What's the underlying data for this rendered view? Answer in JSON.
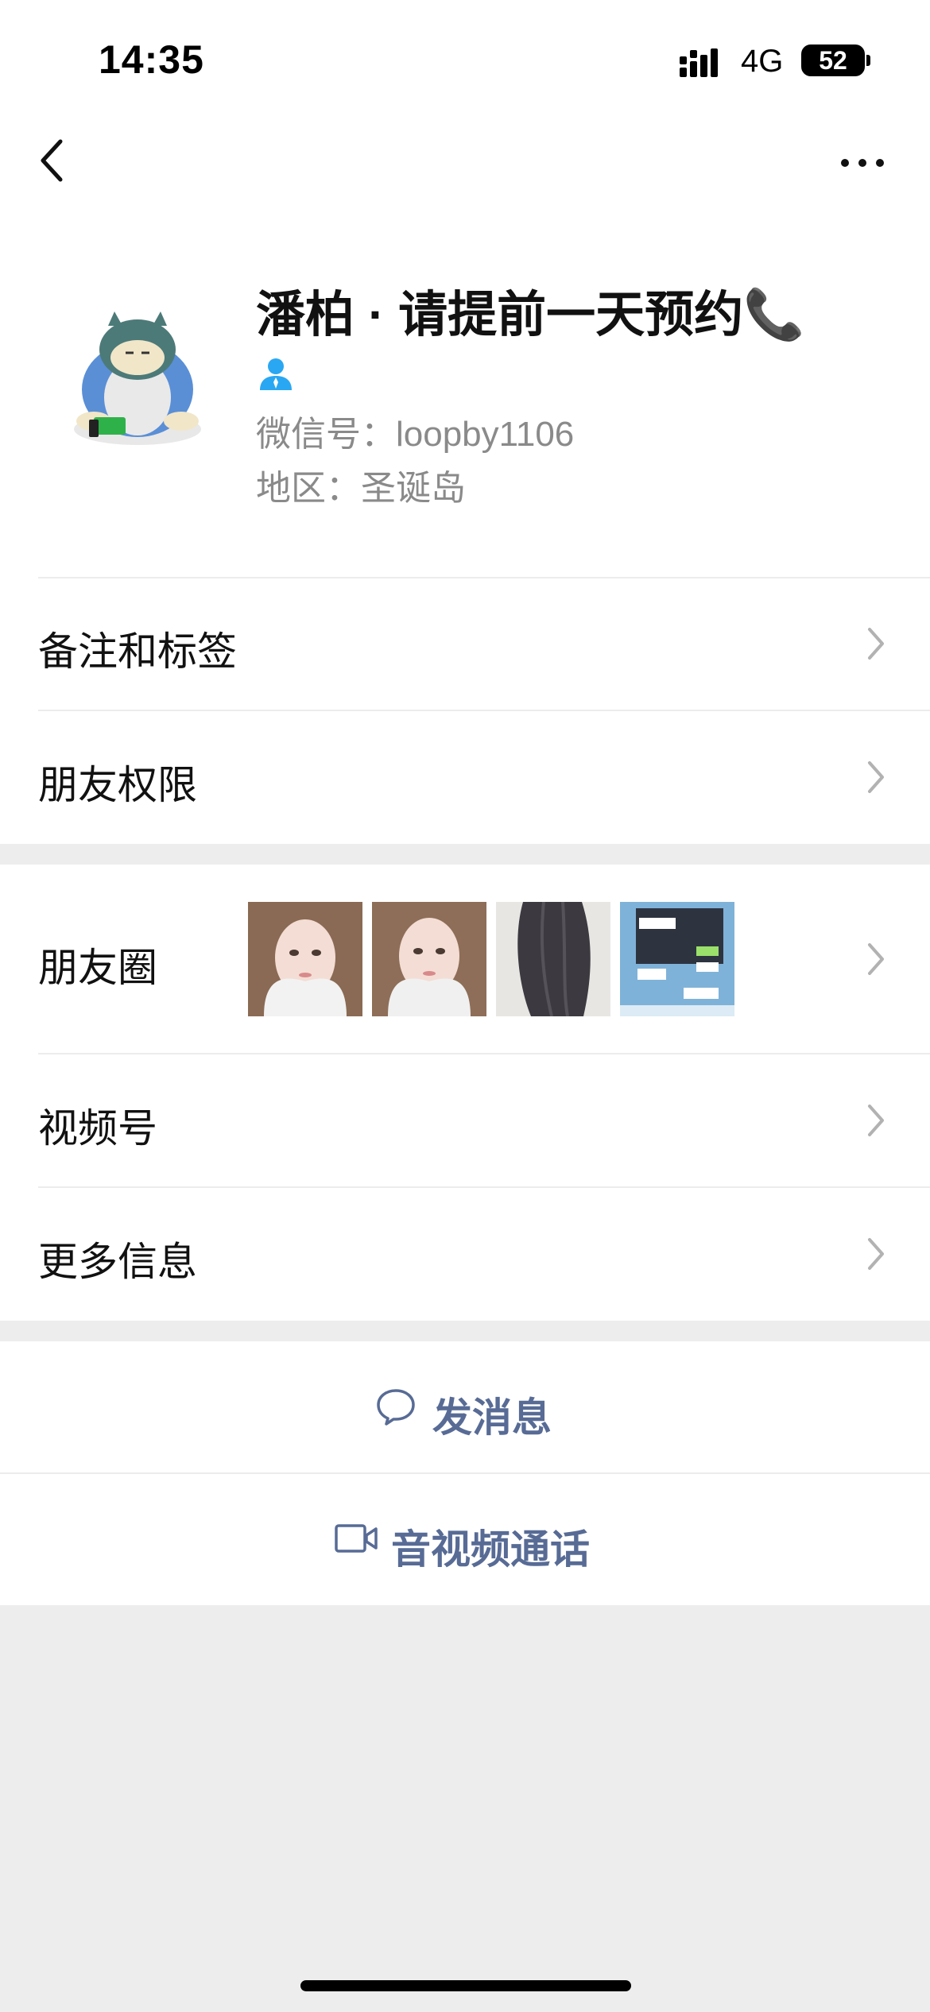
{
  "status_bar": {
    "time": "14:35",
    "network": "4G",
    "battery": "52"
  },
  "nav": {
    "back_icon": "chevron-left-icon",
    "more_icon": "more-dots-icon"
  },
  "profile": {
    "nickname": "潘柏 · 请提前一天预约📞",
    "contact_icon": "person-icon",
    "wechat_id": "微信号：loopby1106",
    "region": "地区：圣诞岛"
  },
  "group1": [
    {
      "label": "备注和标签"
    },
    {
      "label": "朋友权限"
    }
  ],
  "group2": {
    "moments_label": "朋友圈",
    "moments_thumbs": [
      "selfie-photo",
      "selfie-photo",
      "hair-photo",
      "chat-screenshot"
    ],
    "channels_label": "视频号",
    "more_info_label": "更多信息"
  },
  "actions": {
    "message_label": "发消息",
    "message_icon": "chat-bubble-icon",
    "call_label": "音视频通话",
    "call_icon": "video-camera-icon"
  },
  "colors": {
    "accent": "#576b95",
    "background": "#ededed",
    "secondary_text": "#8a8a8a"
  }
}
